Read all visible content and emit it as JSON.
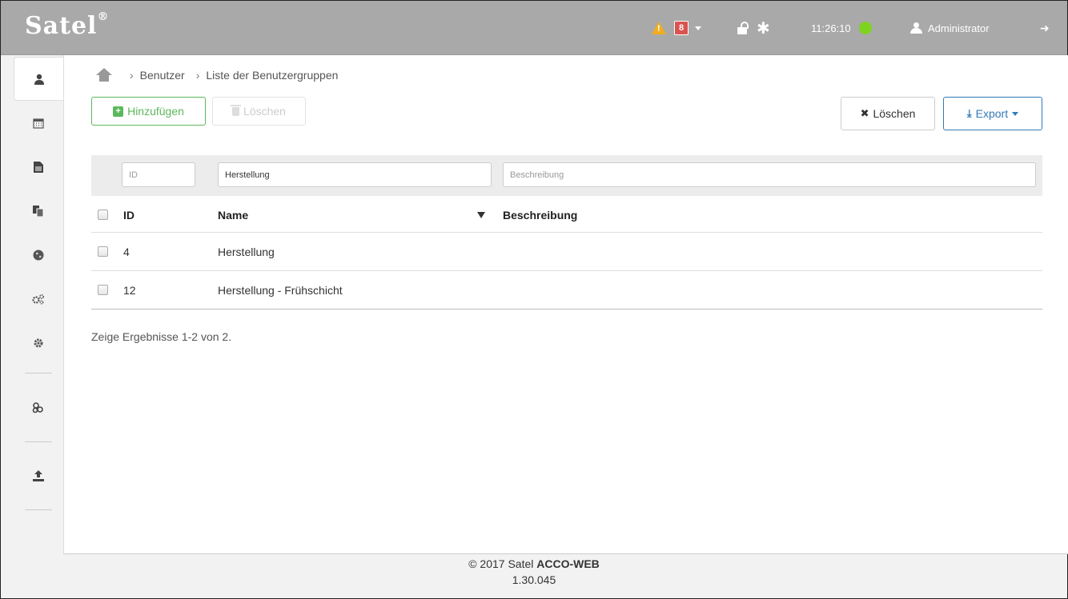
{
  "topbar": {
    "logo": "Satel",
    "logo_mark": "®",
    "warning_symbol": "!",
    "alert_count": "8",
    "clock": "11:26:10",
    "status_color": "#7ed321",
    "user": "Administrator",
    "icons": [
      "warning-icon",
      "unlock-icon",
      "asterisk-icon",
      "user-icon",
      "logout-icon"
    ]
  },
  "sidebar": {
    "items": [
      {
        "name": "users",
        "icon": "user-icon"
      },
      {
        "name": "calendar",
        "icon": "calendar-icon"
      },
      {
        "name": "document",
        "icon": "document-icon"
      },
      {
        "name": "copy",
        "icon": "copy-icon"
      },
      {
        "name": "globe",
        "icon": "globe-icon"
      },
      {
        "name": "cogs",
        "icon": "cogs-icon"
      },
      {
        "name": "settings",
        "icon": "gear-icon"
      },
      {
        "name": "links",
        "icon": "link-icon"
      },
      {
        "name": "upload",
        "icon": "upload-icon"
      }
    ]
  },
  "breadcrumb": {
    "items": [
      "Benutzer",
      "Liste der Benutzergruppen"
    ]
  },
  "toolbar": {
    "add_label": "Hinzufügen",
    "delete_label": "Löschen",
    "clear_label": "Löschen",
    "export_label": "Export"
  },
  "filters": {
    "id_placeholder": "ID",
    "name_value": "Herstellung",
    "description_placeholder": "Beschreibung"
  },
  "table": {
    "columns": [
      "ID",
      "Name",
      "Beschreibung"
    ],
    "rows": [
      {
        "id": "4",
        "name": "Herstellung",
        "description": ""
      },
      {
        "id": "12",
        "name": "Herstellung - Frühschicht",
        "description": ""
      }
    ]
  },
  "summary": "Zeige Ergebnisse 1-2 von 2.",
  "footer": {
    "copyright": "© 2017 Satel",
    "product": "ACCO-WEB",
    "version": "1.30.045"
  },
  "colors": {
    "topbar": "#a9a9a9",
    "primary": "#337ab7",
    "success": "#5cb85c",
    "warning": "#f0ad1e",
    "danger": "#d9534f"
  }
}
